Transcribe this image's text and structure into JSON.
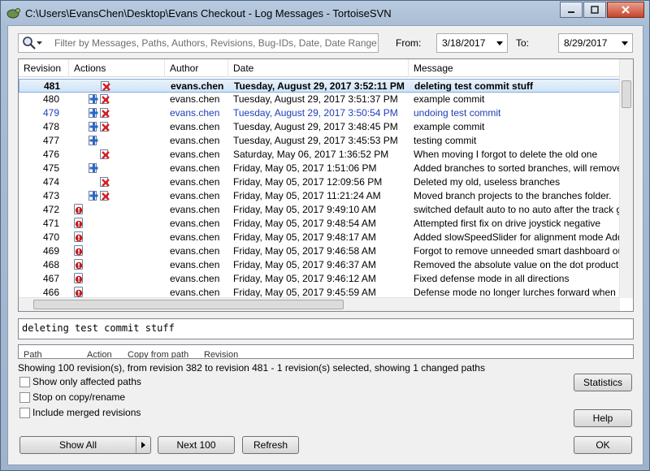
{
  "window": {
    "title": "C:\\Users\\EvansChen\\Desktop\\Evans Checkout - Log Messages - TortoiseSVN"
  },
  "filter": {
    "placeholder": "Filter by Messages, Paths, Authors, Revisions, Bug-IDs, Date, Date Range",
    "from_label": "From:",
    "from_value": "3/18/2017",
    "to_label": "To:",
    "to_value": "8/29/2017"
  },
  "columns": {
    "revision": "Revision",
    "actions": "Actions",
    "author": "Author",
    "date": "Date",
    "message": "Message"
  },
  "rows": [
    {
      "revision": "481",
      "actions": [
        "delete"
      ],
      "author": "evans.chen",
      "date": "Tuesday, August 29, 2017 3:52:11 PM",
      "message": "deleting test commit stuff",
      "selected": true
    },
    {
      "revision": "480",
      "actions": [
        "add",
        "delete"
      ],
      "author": "evans.chen",
      "date": "Tuesday, August 29, 2017 3:51:37 PM",
      "message": "example commit"
    },
    {
      "revision": "479",
      "actions": [
        "add",
        "delete"
      ],
      "author": "evans.chen",
      "date": "Tuesday, August 29, 2017 3:50:54 PM",
      "message": "undoing test commit",
      "highlight": true
    },
    {
      "revision": "478",
      "actions": [
        "add",
        "delete"
      ],
      "author": "evans.chen",
      "date": "Tuesday, August 29, 2017 3:48:45 PM",
      "message": "example commit"
    },
    {
      "revision": "477",
      "actions": [
        "add"
      ],
      "author": "evans.chen",
      "date": "Tuesday, August 29, 2017 3:45:53 PM",
      "message": "testing commit"
    },
    {
      "revision": "476",
      "actions": [
        "delete"
      ],
      "author": "evans.chen",
      "date": "Saturday, May 06, 2017 1:36:52 PM",
      "message": "When moving I forgot to delete the old one"
    },
    {
      "revision": "475",
      "actions": [
        "add"
      ],
      "author": "evans.chen",
      "date": "Friday, May 05, 2017 1:51:06 PM",
      "message": "Added branches to sorted branches, will remove the"
    },
    {
      "revision": "474",
      "actions": [
        "delete"
      ],
      "author": "evans.chen",
      "date": "Friday, May 05, 2017 12:09:56 PM",
      "message": "Deleted my old, useless branches"
    },
    {
      "revision": "473",
      "actions": [
        "add",
        "delete"
      ],
      "author": "evans.chen",
      "date": "Friday, May 05, 2017 11:21:24 AM",
      "message": "Moved branch projects to the branches folder."
    },
    {
      "revision": "472",
      "actions": [
        "modify"
      ],
      "author": "evans.chen",
      "date": "Friday, May 05, 2017 9:49:10 AM",
      "message": "switched default auto to no auto after the track got"
    },
    {
      "revision": "471",
      "actions": [
        "modify"
      ],
      "author": "evans.chen",
      "date": "Friday, May 05, 2017 9:48:54 AM",
      "message": "Attempted first fix on drive joystick negative"
    },
    {
      "revision": "470",
      "actions": [
        "modify"
      ],
      "author": "evans.chen",
      "date": "Friday, May 05, 2017 9:48:17 AM",
      "message": "Added slowSpeedSlider for alignment mode Added ga"
    },
    {
      "revision": "469",
      "actions": [
        "modify"
      ],
      "author": "evans.chen",
      "date": "Friday, May 05, 2017 9:46:58 AM",
      "message": "Forgot to remove unneeded smart dashboard output"
    },
    {
      "revision": "468",
      "actions": [
        "modify"
      ],
      "author": "evans.chen",
      "date": "Friday, May 05, 2017 9:46:37 AM",
      "message": "Removed the absolute value on the dot product taht"
    },
    {
      "revision": "467",
      "actions": [
        "modify"
      ],
      "author": "evans.chen",
      "date": "Friday, May 05, 2017 9:46:12 AM",
      "message": "Fixed defense mode in all directions"
    },
    {
      "revision": "466",
      "actions": [
        "modify"
      ],
      "author": "evans.chen",
      "date": "Friday, May 05, 2017 9:45:59 AM",
      "message": "Defense mode no longer lurches forward when movin"
    }
  ],
  "log_message": "deleting test commit stuff",
  "paths_columns": [
    "Path",
    "Action",
    "Copy from path",
    "Revision"
  ],
  "status_text": "Showing 100 revision(s), from revision 382 to revision 481 - 1 revision(s) selected, showing 1 changed paths",
  "options": {
    "show_affected": "Show only affected paths",
    "stop_on_copy": "Stop on copy/rename",
    "include_merged": "Include merged revisions"
  },
  "buttons": {
    "show_all": "Show All",
    "next_100": "Next 100",
    "refresh": "Refresh",
    "statistics": "Statistics",
    "help": "Help",
    "ok": "OK"
  },
  "colors": {
    "selection": "#d0e4f8",
    "highlight_text": "#1d3fb8",
    "add_icon": "#2a67c9",
    "delete_icon": "#d81e1e",
    "modify_icon": "#c21e1e"
  }
}
